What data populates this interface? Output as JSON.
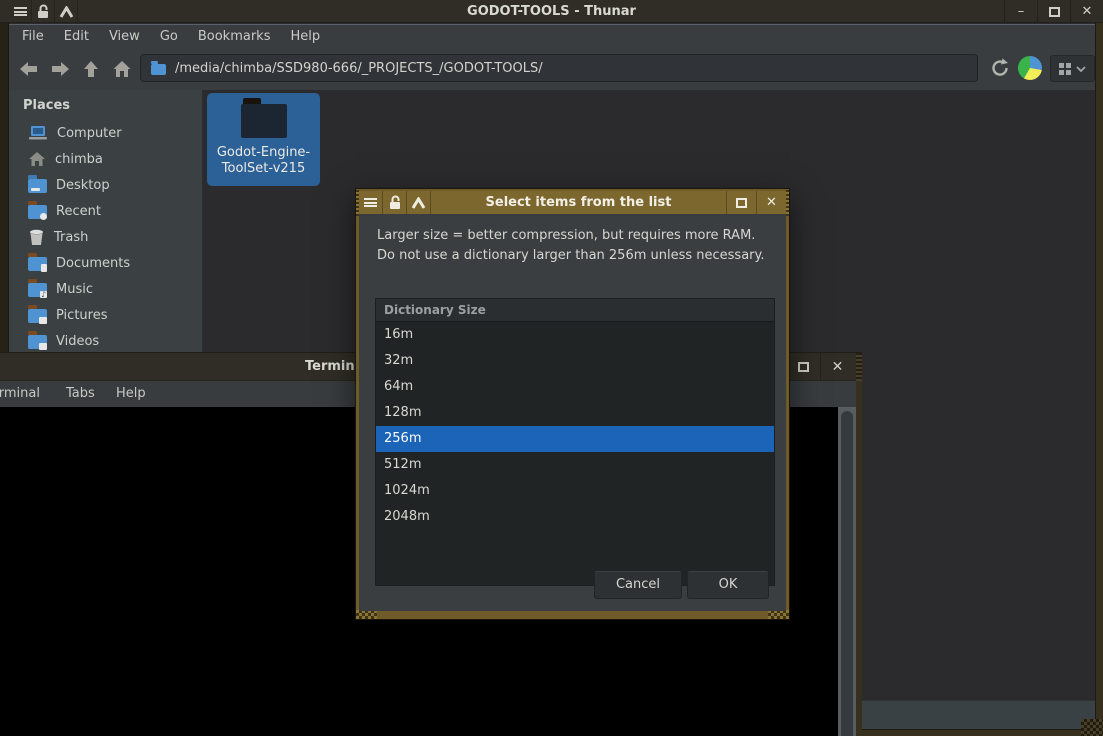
{
  "glyphs": {
    "minimize": "–",
    "close": "✕",
    "music_note": "♪"
  },
  "colors": {
    "titlebar_active": "#7c682f",
    "titlebar_inactive": "#2f2d25",
    "selection_blue": "#1b64b8",
    "folder_selection_blue": "#2c6197",
    "chrome_gray": "#393d40",
    "sidebar_gray": "#3b4043",
    "fileview_bg": "#2b2b2d",
    "frame_brown": "#37301e",
    "dialog_frame_gold": "#6e5b28",
    "pie_blue": "#4f93d3",
    "pie_yellow": "#f2ee58",
    "pie_green": "#39b44a"
  },
  "thunar_window": {
    "title": "GODOT-TOOLS - Thunar",
    "titlebar_icons": [
      "window-menu-icon",
      "unlock-icon",
      "shade-up-icon"
    ],
    "menubar": {
      "items": [
        "File",
        "Edit",
        "View",
        "Go",
        "Bookmarks",
        "Help"
      ]
    },
    "toolbar": {
      "nav_icons": [
        "back-icon",
        "forward-icon",
        "up-icon",
        "home-icon"
      ],
      "path_value": "/media/chimba/SSD980-666/_PROJECTS_/GODOT-TOOLS/",
      "right_icons": [
        "refresh-icon",
        "disk-usage-pie-icon",
        "view-grid-icon",
        "chevron-down-icon"
      ]
    },
    "sidebar": {
      "header": "Places",
      "items": [
        {
          "label": "Computer",
          "icon": "computer-icon"
        },
        {
          "label": "chimba",
          "icon": "home-icon"
        },
        {
          "label": "Desktop",
          "icon": "desktop-icon"
        },
        {
          "label": "Recent",
          "icon": "recent-folder-icon"
        },
        {
          "label": "Trash",
          "icon": "trash-icon"
        },
        {
          "label": "Documents",
          "icon": "documents-folder-icon"
        },
        {
          "label": "Music",
          "icon": "music-folder-icon"
        },
        {
          "label": "Pictures",
          "icon": "pictures-folder-icon"
        },
        {
          "label": "Videos",
          "icon": "videos-folder-icon"
        }
      ]
    },
    "fileview": {
      "selected_item_name": "Godot-Engine-ToolSet-v215"
    }
  },
  "dialog": {
    "title": "Select items from the list",
    "message_line1": "Larger size = better compression, but requires more RAM.",
    "message_line2": "Do not use a dictionary larger than 256m unless necessary.",
    "list": {
      "header": "Dictionary Size",
      "items": [
        "16m",
        "32m",
        "64m",
        "128m",
        "256m",
        "512m",
        "1024m",
        "2048m"
      ],
      "selected": "256m"
    },
    "buttons": {
      "cancel": "Cancel",
      "ok": "OK"
    }
  },
  "terminal_window": {
    "title": "Terminal",
    "menubar": {
      "items": [
        "Terminal",
        "Tabs",
        "Help"
      ]
    }
  }
}
